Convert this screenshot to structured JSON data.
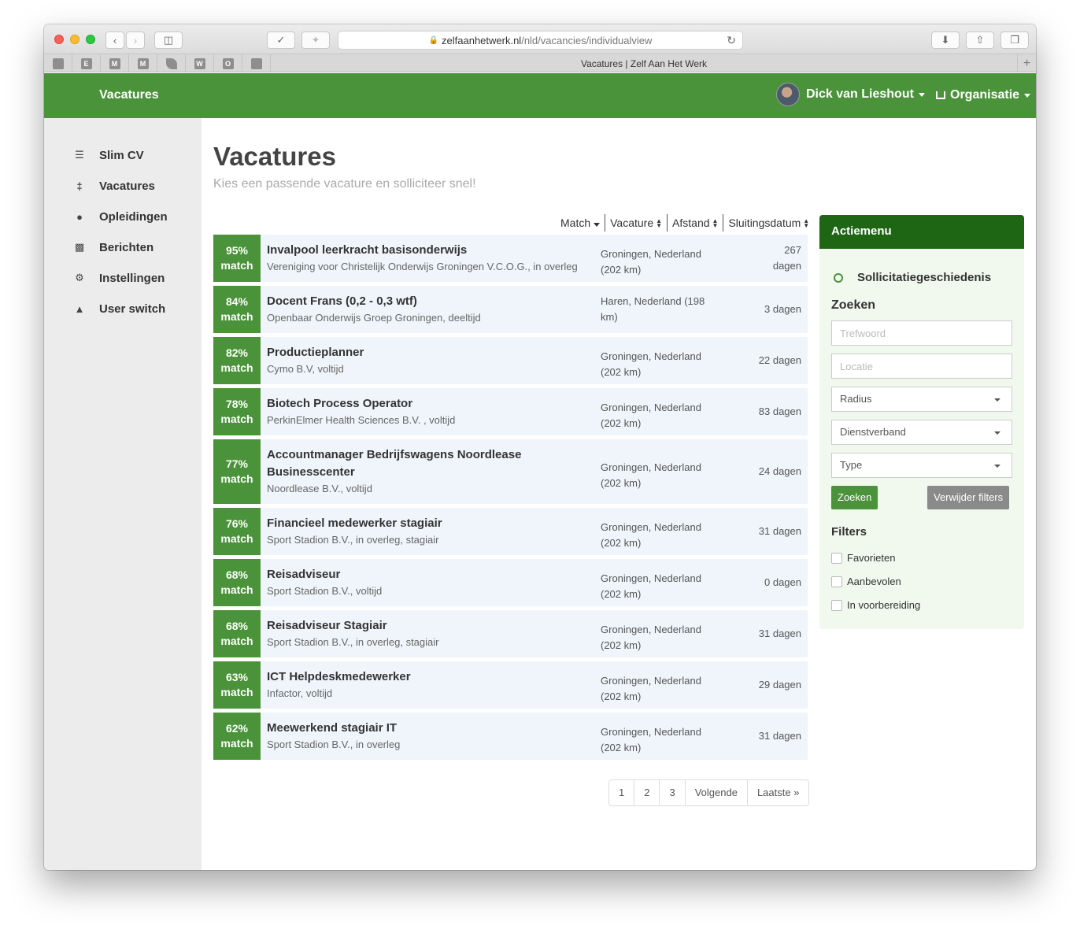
{
  "browser": {
    "url_domain": "zelfaanhetwerk.nl",
    "url_path": "/nld/vacancies/individualview",
    "tab_title": "Vacatures | Zelf Aan Het Werk",
    "bookmarks": [
      "",
      "E",
      "M",
      "M",
      "",
      "W",
      "O",
      ""
    ]
  },
  "nav": {
    "brand": "Vacatures",
    "user_name": "Dick van Lieshout",
    "org_label": "Organisatie"
  },
  "sidebar": {
    "items": [
      {
        "label": "Slim CV",
        "icon": "cv-icon"
      },
      {
        "label": "Vacatures",
        "icon": "signpost-icon"
      },
      {
        "label": "Opleidingen",
        "icon": "education-icon"
      },
      {
        "label": "Berichten",
        "icon": "messages-icon"
      },
      {
        "label": "Instellingen",
        "icon": "settings-icon"
      },
      {
        "label": "User switch",
        "icon": "user-switch-icon"
      }
    ]
  },
  "main": {
    "title": "Vacatures",
    "subtitle": "Kies een passende vacature en solliciteer snel!",
    "sort": {
      "match": "Match",
      "vacature": "Vacature",
      "afstand": "Afstand",
      "sluitingsdatum": "Sluitingsdatum"
    },
    "match_suffix": "match",
    "vacancies": [
      {
        "pct": "95%",
        "title": "Invalpool leerkracht basisonderwijs",
        "org": "Vereniging voor Christelijk Onderwijs Groningen V.C.O.G., in overleg",
        "location": "Groningen, Nederland (202 km)",
        "days": "267 dagen"
      },
      {
        "pct": "84%",
        "title": "Docent Frans (0,2 - 0,3 wtf)",
        "org": "Openbaar Onderwijs Groep Groningen, deeltijd",
        "location": "Haren, Nederland (198 km)",
        "days": "3 dagen"
      },
      {
        "pct": "82%",
        "title": "Productieplanner",
        "org": "Cymo B.V, voltijd",
        "location": "Groningen, Nederland (202 km)",
        "days": "22 dagen"
      },
      {
        "pct": "78%",
        "title": "Biotech Process Operator",
        "org": "PerkinElmer Health Sciences B.V. , voltijd",
        "location": "Groningen, Nederland (202 km)",
        "days": "83 dagen"
      },
      {
        "pct": "77%",
        "title": "Accountmanager Bedrijfswagens Noordlease Businesscenter",
        "org": "Noordlease B.V., voltijd",
        "location": "Groningen, Nederland (202 km)",
        "days": "24 dagen"
      },
      {
        "pct": "76%",
        "title": "Financieel medewerker stagiair",
        "org": "Sport Stadion B.V., in overleg, stagiair",
        "location": "Groningen, Nederland (202 km)",
        "days": "31 dagen"
      },
      {
        "pct": "68%",
        "title": "Reisadviseur",
        "org": "Sport Stadion B.V., voltijd",
        "location": "Groningen, Nederland (202 km)",
        "days": "0 dagen"
      },
      {
        "pct": "68%",
        "title": "Reisadviseur Stagiair",
        "org": "Sport Stadion B.V., in overleg, stagiair",
        "location": "Groningen, Nederland (202 km)",
        "days": "31 dagen"
      },
      {
        "pct": "63%",
        "title": "ICT Helpdeskmedewerker",
        "org": "Infactor, voltijd",
        "location": "Groningen, Nederland (202 km)",
        "days": "29 dagen"
      },
      {
        "pct": "62%",
        "title": "Meewerkend stagiair IT",
        "org": "Sport Stadion B.V., in overleg",
        "location": "Groningen, Nederland (202 km)",
        "days": "31 dagen"
      }
    ],
    "pagination": [
      "1",
      "2",
      "3",
      "Volgende",
      "Laatste »"
    ]
  },
  "action_menu": {
    "title": "Actiemenu",
    "history": "Sollicitatiegeschiedenis",
    "search_heading": "Zoeken",
    "keyword_placeholder": "Trefwoord",
    "location_placeholder": "Locatie",
    "radius": "Radius",
    "employment": "Dienstverband",
    "type": "Type",
    "search_button": "Zoeken",
    "clear_button": "Verwijder filters",
    "filters_heading": "Filters",
    "filters": [
      "Favorieten",
      "Aanbevolen",
      "In voorbereiding"
    ]
  },
  "colors": {
    "brand_green": "#4a933a",
    "dark_green": "#1e6614",
    "row_bg": "#f0f5fb"
  }
}
